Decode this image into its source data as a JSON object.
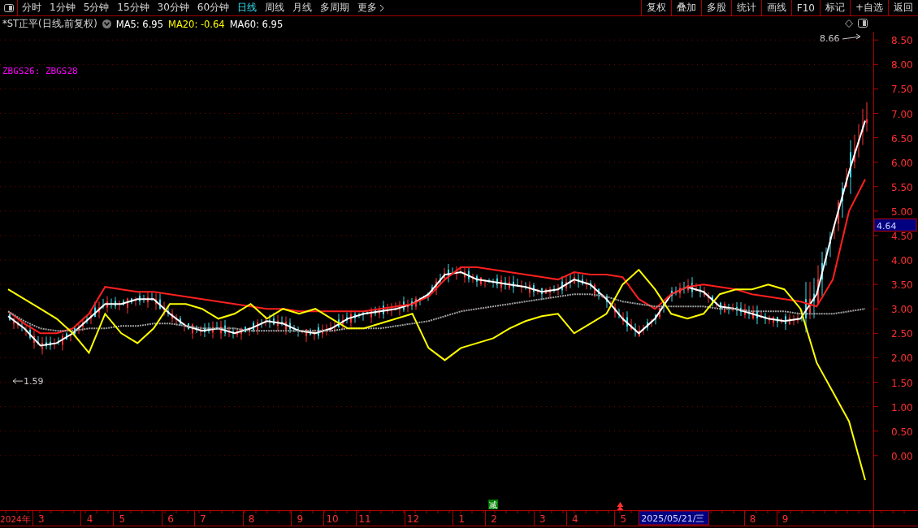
{
  "toolbar": {
    "tabs": [
      {
        "label": "分时",
        "selected": false
      },
      {
        "label": "1分钟",
        "selected": false
      },
      {
        "label": "5分钟",
        "selected": false
      },
      {
        "label": "15分钟",
        "selected": false
      },
      {
        "label": "30分钟",
        "selected": false
      },
      {
        "label": "60分钟",
        "selected": false
      },
      {
        "label": "日线",
        "selected": true
      },
      {
        "label": "周线",
        "selected": false
      },
      {
        "label": "月线",
        "selected": false
      },
      {
        "label": "多周期",
        "selected": false
      },
      {
        "label": "更多",
        "selected": false
      }
    ],
    "buttons": [
      "复权",
      "叠加",
      "多股",
      "统计",
      "画线",
      "F10",
      "标记",
      "+自选",
      "返回"
    ]
  },
  "legend": {
    "title": "*ST正平(日线,前复权)",
    "items": [
      {
        "label": "MA5: 6.95",
        "color": "#ffffff"
      },
      {
        "label": "MA20: -0.64",
        "color": "#ffff00"
      },
      {
        "label": "MA60: 6.95",
        "color": "#ffffff"
      }
    ]
  },
  "indicator_label": "ZBGS26: ZBGS28",
  "high_label": "8.66",
  "low_label": "1.59",
  "current_price": "4.64",
  "signal": "减",
  "year_label": "2024年",
  "cursor_date": "2025/05/21/三",
  "chart_data": {
    "type": "line",
    "grid": true,
    "ylim": [
      -1.1,
      8.67
    ],
    "categories": [
      null,
      null,
      "3",
      null,
      null,
      "4",
      null,
      "5",
      null,
      null,
      "6",
      null,
      "7",
      null,
      null,
      "8",
      null,
      null,
      "9",
      null,
      "10",
      null,
      "11",
      null,
      null,
      "12",
      null,
      null,
      "1",
      null,
      "2",
      null,
      null,
      "3",
      null,
      "4",
      null,
      null,
      "5",
      null,
      null,
      null,
      null,
      null,
      null,
      null,
      "8",
      null,
      "9",
      null,
      null,
      null,
      null,
      null
    ],
    "yticks": [
      {
        "value": 0,
        "label": "0.00"
      },
      {
        "value": 0.5,
        "label": "0.50"
      },
      {
        "value": 1,
        "label": "1.00"
      },
      {
        "value": 1.5,
        "label": "1.50"
      },
      {
        "value": 2,
        "label": "2.00"
      },
      {
        "value": 2.5,
        "label": "2.50"
      },
      {
        "value": 3,
        "label": "3.00"
      },
      {
        "value": 3.5,
        "label": "3.50"
      },
      {
        "value": 4,
        "label": "4.00"
      },
      {
        "value": 4.5,
        "label": "4.50"
      },
      {
        "value": 5,
        "label": "5.00"
      },
      {
        "value": 5.5,
        "label": "5.50"
      },
      {
        "value": 6,
        "label": "6.00"
      },
      {
        "value": 6.5,
        "label": "6.50"
      },
      {
        "value": 7,
        "label": "7.00"
      },
      {
        "value": 7.5,
        "label": "7.50"
      },
      {
        "value": 8,
        "label": "8.00"
      },
      {
        "value": 8.5,
        "label": "8.50"
      }
    ],
    "series": [
      {
        "color": "#ffffff",
        "values": [
          2.85,
          2.6,
          2.25,
          2.3,
          2.5,
          2.8,
          3.1,
          3.1,
          3.2,
          3.2,
          2.9,
          2.65,
          2.55,
          2.6,
          2.5,
          2.6,
          2.75,
          2.7,
          2.55,
          2.5,
          2.6,
          2.8,
          2.9,
          2.95,
          3.0,
          3.1,
          3.3,
          3.7,
          3.75,
          3.6,
          3.55,
          3.5,
          3.45,
          3.35,
          3.4,
          3.6,
          3.5,
          3.2,
          2.8,
          2.5,
          2.8,
          3.3,
          3.45,
          3.35,
          3.05,
          3.0,
          2.9,
          2.8,
          2.75,
          2.8,
          3.3,
          4.6,
          5.8,
          6.85
        ]
      },
      {
        "color": "#ff2020",
        "values": [
          2.95,
          2.7,
          2.5,
          2.5,
          2.6,
          2.9,
          3.45,
          3.4,
          3.35,
          3.35,
          3.3,
          3.25,
          3.2,
          3.15,
          3.1,
          3.05,
          3.0,
          3.0,
          2.95,
          2.95,
          2.95,
          2.95,
          2.95,
          3.0,
          3.05,
          3.1,
          3.25,
          3.6,
          3.85,
          3.85,
          3.8,
          3.75,
          3.7,
          3.65,
          3.6,
          3.75,
          3.7,
          3.7,
          3.65,
          3.2,
          3.0,
          3.3,
          3.45,
          3.5,
          3.45,
          3.4,
          3.3,
          3.25,
          3.2,
          3.15,
          3.05,
          3.6,
          5.0,
          5.65
        ]
      },
      {
        "color": "#a0a0a0",
        "line_style": "dotted",
        "values": [
          2.95,
          2.75,
          2.6,
          2.55,
          2.55,
          2.6,
          2.6,
          2.65,
          2.65,
          2.7,
          2.7,
          2.65,
          2.6,
          2.6,
          2.6,
          2.55,
          2.55,
          2.55,
          2.55,
          2.55,
          2.55,
          2.6,
          2.6,
          2.6,
          2.65,
          2.7,
          2.75,
          2.85,
          2.95,
          3.0,
          3.05,
          3.1,
          3.15,
          3.2,
          3.25,
          3.3,
          3.3,
          3.25,
          3.15,
          3.1,
          3.05,
          3.05,
          3.05,
          3.05,
          3.0,
          3.0,
          2.95,
          2.95,
          2.95,
          2.9,
          2.9,
          2.9,
          2.95,
          3.0
        ]
      },
      {
        "color": "#ffff00",
        "values": [
          3.4,
          3.2,
          3.0,
          2.8,
          2.5,
          2.1,
          2.9,
          2.5,
          2.3,
          2.6,
          3.1,
          3.1,
          3.0,
          2.8,
          2.9,
          3.1,
          2.8,
          3.0,
          2.9,
          3.0,
          2.8,
          2.6,
          2.6,
          2.7,
          2.8,
          2.9,
          2.2,
          1.95,
          2.2,
          2.3,
          2.4,
          2.6,
          2.75,
          2.85,
          2.9,
          2.5,
          2.7,
          2.9,
          3.5,
          3.8,
          3.4,
          2.9,
          2.8,
          2.9,
          3.3,
          3.4,
          3.4,
          3.5,
          3.4,
          3.0,
          1.9,
          1.3,
          0.7,
          -0.5
        ]
      }
    ]
  }
}
